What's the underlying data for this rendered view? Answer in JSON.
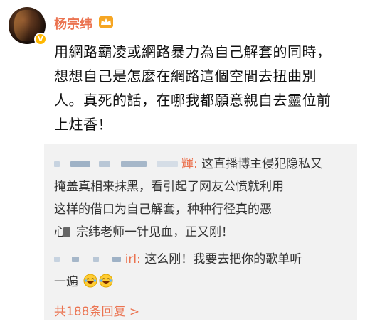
{
  "post": {
    "username": "杨宗纬",
    "lines": [
      "用網路霸凌或網路暴力為自己解套的同時，",
      "想想自己是怎麼在網路這個空間去扭曲別",
      "人。真死的話，在哪我都願意親自去靈位前",
      "上炷香！"
    ]
  },
  "comments": [
    {
      "name_suffix": "輝:",
      "lines": [
        " 这直播博主侵犯隐私又",
        "掩盖真相来抹黑，看引起了网友公愤就利用",
        "这样的借口为自己解套，种种行径真的恶",
        "宗纬老师一针见血，正又刚！"
      ],
      "partial": "心"
    },
    {
      "name_suffix": "irl:",
      "lines": [
        " 这么刚！我要去把你的歌单听",
        "一遍"
      ]
    }
  ],
  "more_replies": "共188条回复 >",
  "icons": {
    "avatar": "avatar",
    "verified": "verified-badge-icon",
    "crown": "crown-icon",
    "emoji": "laughing-tears-emoji-icon"
  }
}
